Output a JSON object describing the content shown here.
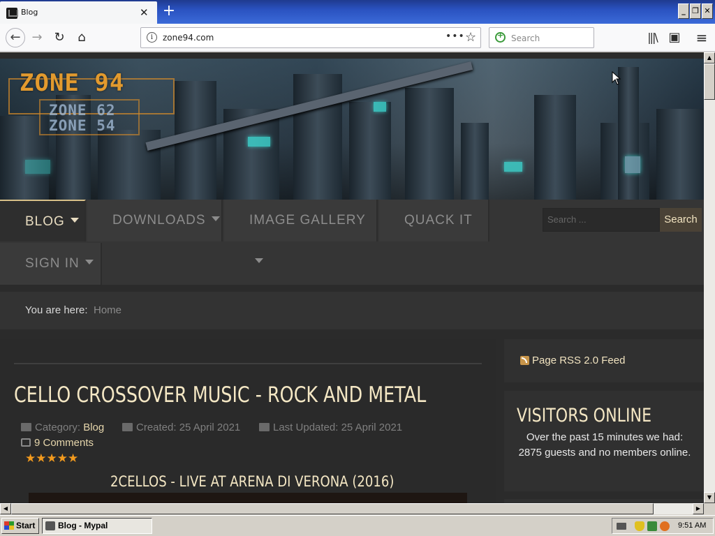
{
  "browser": {
    "tab_title": "Blog",
    "url": "zone94.com",
    "search_placeholder": "Search",
    "tab_close": "✕",
    "new_tab": "+",
    "more_actions": "•••",
    "bookmark_star": "☆"
  },
  "site": {
    "logo_main": "ZONE 94",
    "logo_sub1": "ZONE 62",
    "logo_sub2": "ZONE 54",
    "menu": [
      {
        "label": "BLOG"
      },
      {
        "label": "DOWNLOADS"
      },
      {
        "label": "IMAGE GALLERY"
      },
      {
        "label": "QUACK IT"
      },
      {
        "label": "SIGN IN"
      }
    ],
    "search_placeholder": "Search ...",
    "search_button": "Search",
    "breadcrumb_label": "You are here:",
    "breadcrumb_home": "Home"
  },
  "article": {
    "title": "CELLO CROSSOVER MUSIC - ROCK AND METAL",
    "category_label": "Category:",
    "category": "Blog",
    "created": "Created: 25 April 2021",
    "updated": "Last Updated: 25 April 2021",
    "comments": "9 Comments",
    "stars": "★★★★★",
    "rating": 5,
    "video_title": "2CELLOS - LIVE AT ARENA DI VERONA (2016)"
  },
  "sidebar": {
    "rss": "Page RSS 2.0 Feed",
    "visitors_title": "VISITORS ONLINE",
    "visitors_text": "Over the past 15 minutes we had: 2875 guests and no members online."
  },
  "taskbar": {
    "start": "Start",
    "task": "Blog - Mypal",
    "time": "9:51 AM"
  },
  "colors": {
    "accent_cream": "#f4e7c4",
    "link_gold": "#e6d6ac",
    "star_orange": "#f29a1e",
    "logo_orange": "#e29a2e"
  }
}
